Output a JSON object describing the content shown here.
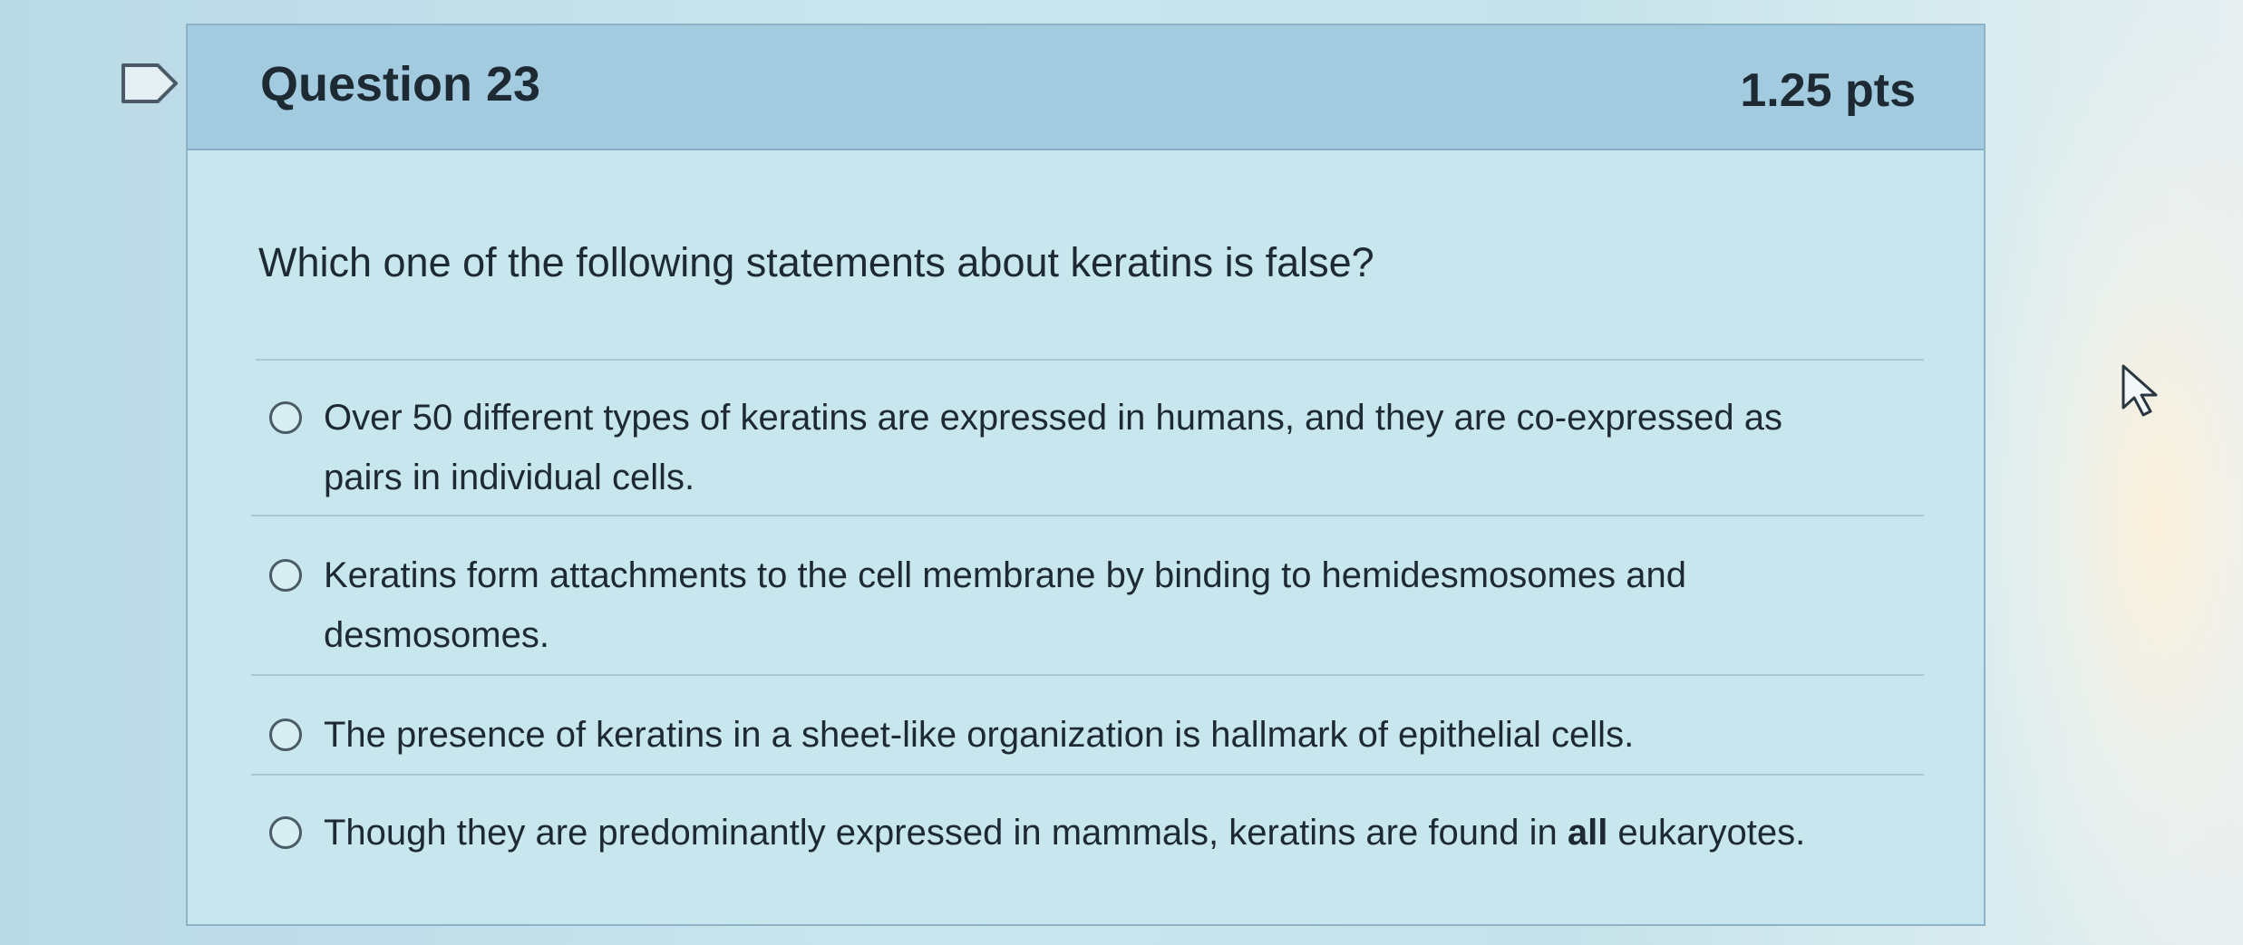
{
  "question": {
    "title": "Question 23",
    "points": "1.25 pts",
    "prompt": "Which one of the following statements about keratins is false?"
  },
  "answers": [
    {
      "text": "Over 50 different types of keratins are expressed in humans, and they are co-expressed as pairs in individual cells.",
      "selected": false
    },
    {
      "text": "Keratins form attachments to the cell membrane by binding to hemidesmosomes and desmosomes.",
      "selected": false
    },
    {
      "text": "The presence of keratins in a sheet-like organization is hallmark of epithelial cells.",
      "selected": false
    },
    {
      "text_before": "Though they are predominantly expressed in mammals, keratins are found in ",
      "text_emphasis": "all",
      "text_after": " eukaryotes.",
      "selected": false
    }
  ],
  "icons": {
    "flag": "flag-question-icon",
    "cursor": "mouse-pointer-icon",
    "radio": "radio-button-icon"
  },
  "colors": {
    "header_bg": "#a3cbe0",
    "body_bg": "#c8e6ee",
    "text": "#1e2a33",
    "border": "#8fb3c6"
  }
}
